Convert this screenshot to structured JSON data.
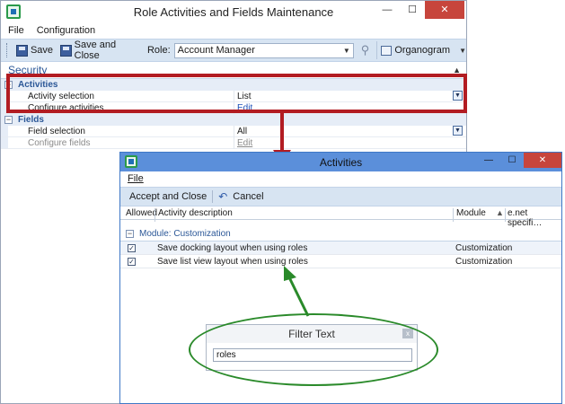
{
  "main_window": {
    "title": "Role Activities and Fields Maintenance",
    "controls": {
      "minimize": "—",
      "maximize": "☐",
      "close": "✕"
    },
    "menu": [
      "File",
      "Configuration"
    ],
    "toolbar": {
      "save_label": "Save",
      "save_close_label": "Save and Close",
      "role_label": "Role:",
      "role_value": "Account Manager",
      "organogram_label": "Organogram"
    },
    "section_title": "Security",
    "categories": [
      {
        "name": "Activities",
        "rows": [
          {
            "name": "Activity selection",
            "value": "List"
          },
          {
            "name": "Configure activities",
            "value": "Edit"
          }
        ]
      },
      {
        "name": "Fields",
        "rows": [
          {
            "name": "Field selection",
            "value": "All"
          },
          {
            "name": "Configure fields",
            "value": "Edit"
          }
        ]
      }
    ]
  },
  "activities_window": {
    "title": "Activities",
    "controls": {
      "minimize": "—",
      "maximize": "☐",
      "close": "✕"
    },
    "menu": [
      "File"
    ],
    "toolbar": {
      "accept_close_label": "Accept and Close",
      "cancel_label": "Cancel"
    },
    "columns": [
      "Allowed",
      "Activity description",
      "Module",
      "e.net specifi…"
    ],
    "group_label": "Module: Customization",
    "rows": [
      {
        "allowed": true,
        "description": "Save docking layout when using roles",
        "module": "Customization"
      },
      {
        "allowed": true,
        "description": "Save list view layout when using roles",
        "module": "Customization"
      }
    ]
  },
  "filter_dialog": {
    "title": "Filter Text",
    "value": "roles",
    "close_label": "x"
  },
  "colors": {
    "highlight": "#b21c22",
    "callout": "#2a8a2a",
    "accent": "#2b5797"
  }
}
